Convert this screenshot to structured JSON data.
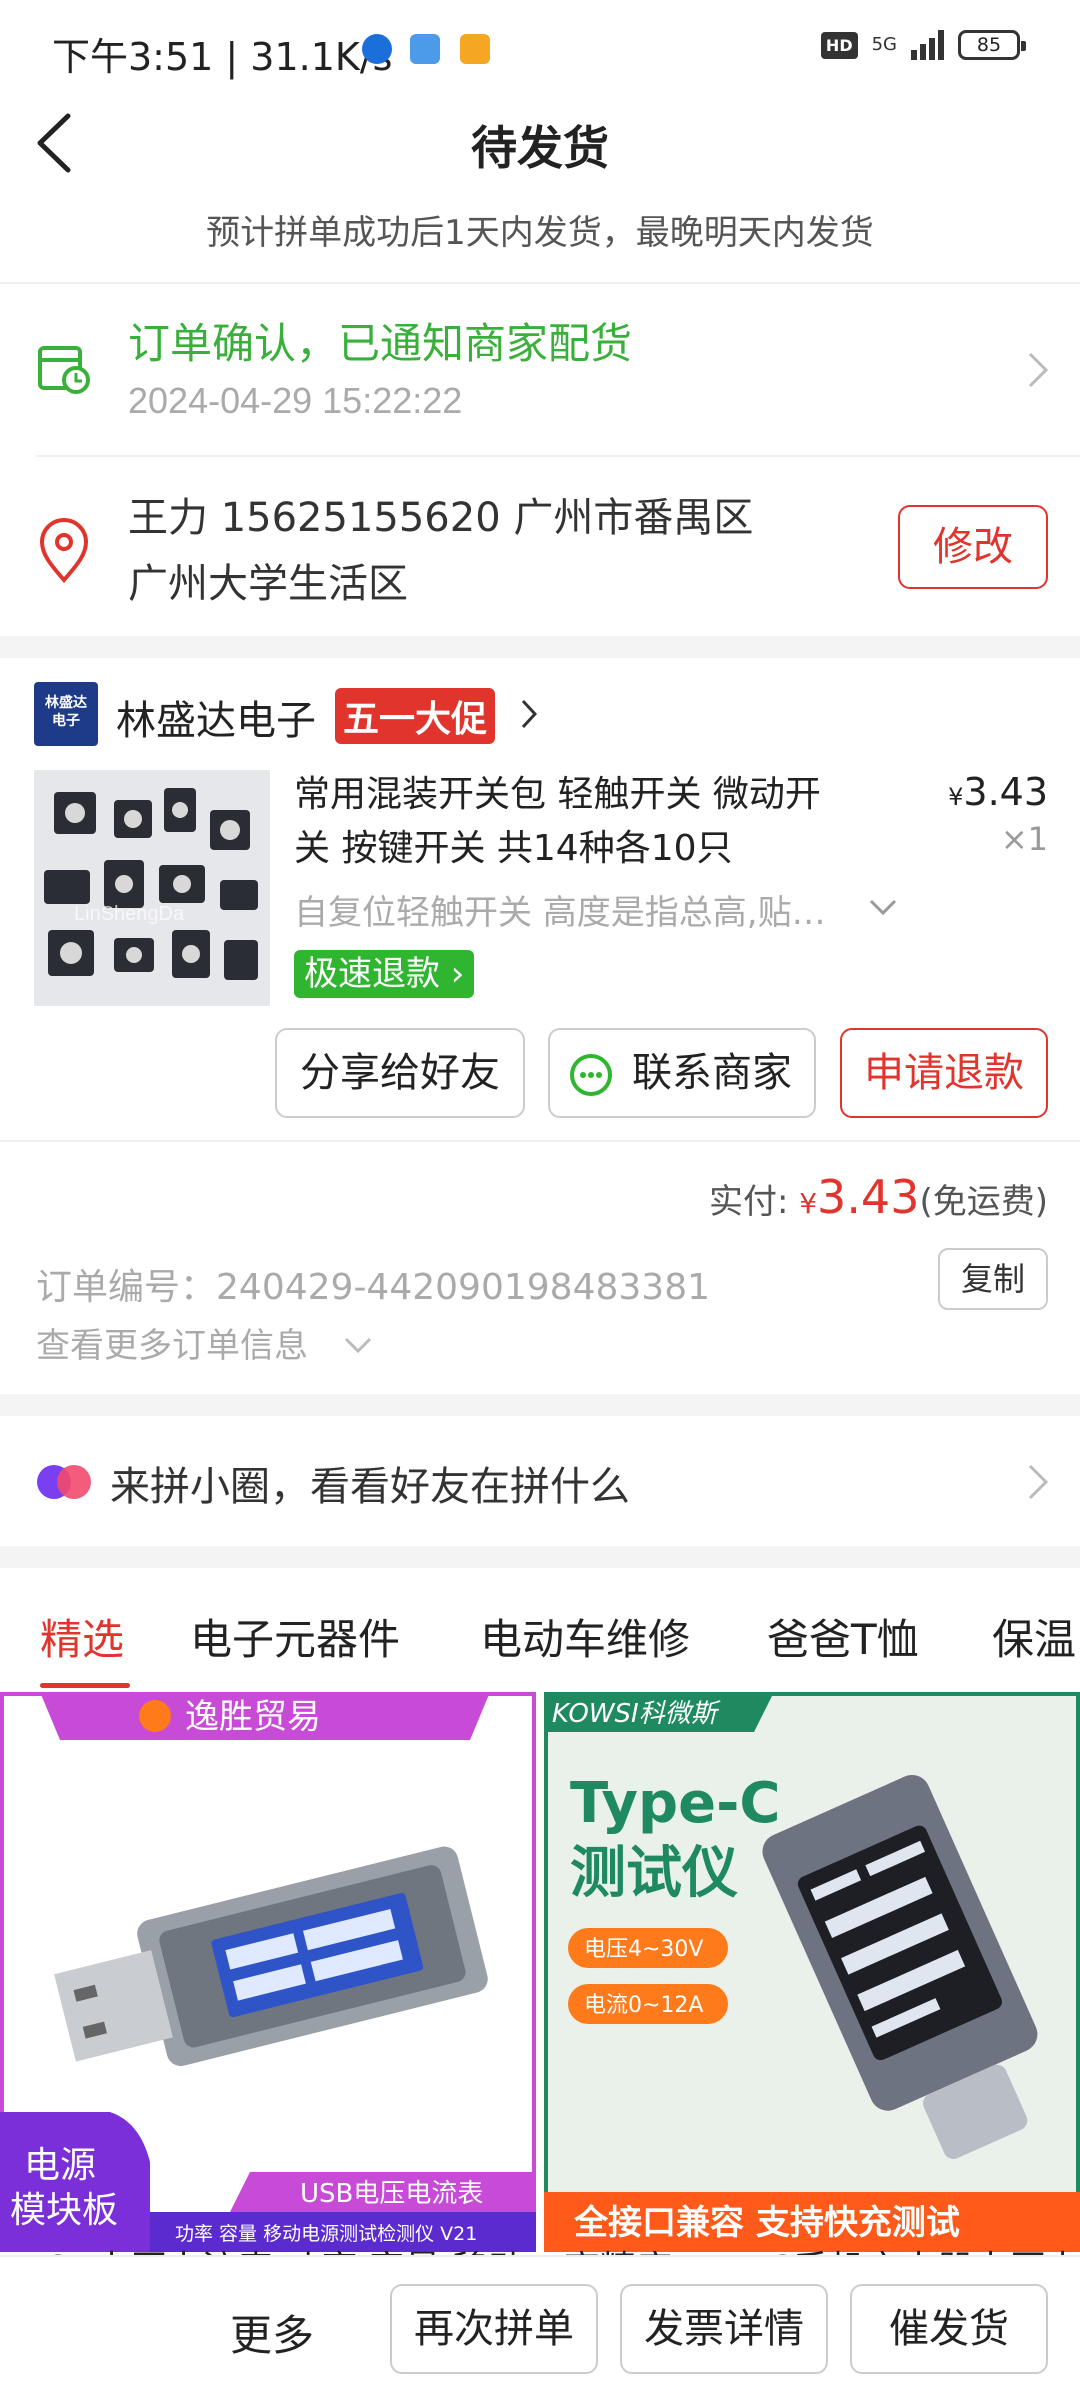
{
  "status_bar": {
    "time": "下午3:51 | 31.1K/s",
    "hd": "HD",
    "network": "5G",
    "battery": "85"
  },
  "header": {
    "title": "待发货",
    "subtitle": "预计拼单成功后1天内发货，最晚明天内发货"
  },
  "order_status": {
    "title": "订单确认，已通知商家配货",
    "time": "2024-04-29 15:22:22"
  },
  "address": {
    "line1": "王力  15625155620  广州市番禺区",
    "line2": "广州大学生活区",
    "edit_label": "修改"
  },
  "shop": {
    "logo_line1": "林盛达",
    "logo_line2": "电子",
    "name": "林盛达电子",
    "promo": "五一大促"
  },
  "product": {
    "title_line1": "常用混装开关包 轻触开关 微动开",
    "title_line2": "关 按键开关 共14种各10只",
    "currency": "¥",
    "price": "3.43",
    "qty": "×1",
    "spec": "自复位轻触开关 高度是指总高,贴…",
    "fast_refund": "极速退款",
    "watermark": "LinShengDa"
  },
  "order_actions": {
    "share": "分享给好友",
    "contact": "联系商家",
    "refund": "申请退款"
  },
  "payment": {
    "label": "实付: ",
    "currency": "¥",
    "amount": "3.43",
    "note": "(免运费)"
  },
  "order_info": {
    "number_label": "订单编号：",
    "number": "240429-442090198483381",
    "copy_label": "复制",
    "more_label": "查看更多订单信息"
  },
  "circle": {
    "text": "来拼小圈，看看好友在拼什么"
  },
  "tabs": [
    "精选",
    "电子元器件",
    "电动车维修",
    "爸爸T恤",
    "保温"
  ],
  "cards": [
    {
      "brand": "逸胜贸易",
      "corner_line1": "电源",
      "corner_line2": "模块板",
      "ribbon": "USB电压电流表",
      "footer": "功率 容量 移动电源测试检测仪 V21",
      "caption": "USB电压电流表 功率 容量 移动电源测试检测仪"
    },
    {
      "brand": "KOWSI科微斯",
      "headline1": "Type-C",
      "headline2": "测试仪",
      "pill1": "电压4~30V",
      "pill2": "电流0~12A",
      "footer": "全接口兼容 支持快充测试",
      "caption": "高精度Type-C手机充电器电压电流测试仪"
    }
  ],
  "bottom_bar": {
    "more": "更多",
    "regroup": "再次拼单",
    "invoice": "发票详情",
    "urge": "催发货"
  },
  "colors": {
    "accent_red": "#e0342c",
    "success_green": "#38b03a",
    "refund_green": "#2fb52f"
  }
}
